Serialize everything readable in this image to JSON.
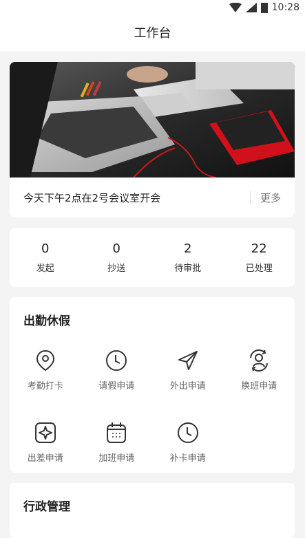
{
  "status": {
    "time": "10:28"
  },
  "header": {
    "title": "工作台"
  },
  "banner": {
    "notice": "今天下午2点在2号会议室开会",
    "more_label": "更多"
  },
  "stats": [
    {
      "value": "0",
      "label": "发起"
    },
    {
      "value": "0",
      "label": "抄送"
    },
    {
      "value": "2",
      "label": "待审批"
    },
    {
      "value": "22",
      "label": "已处理"
    }
  ],
  "attendance": {
    "title": "出勤休假",
    "items": [
      {
        "label": "考勤打卡",
        "icon": "location-pin-icon"
      },
      {
        "label": "请假申请",
        "icon": "clock-icon"
      },
      {
        "label": "外出申请",
        "icon": "paper-plane-icon"
      },
      {
        "label": "换班申请",
        "icon": "user-swap-icon"
      },
      {
        "label": "出差申请",
        "icon": "airplane-icon"
      },
      {
        "label": "加班申请",
        "icon": "calendar-icon"
      },
      {
        "label": "补卡申请",
        "icon": "clock-icon"
      }
    ]
  },
  "admin": {
    "title": "行政管理"
  }
}
